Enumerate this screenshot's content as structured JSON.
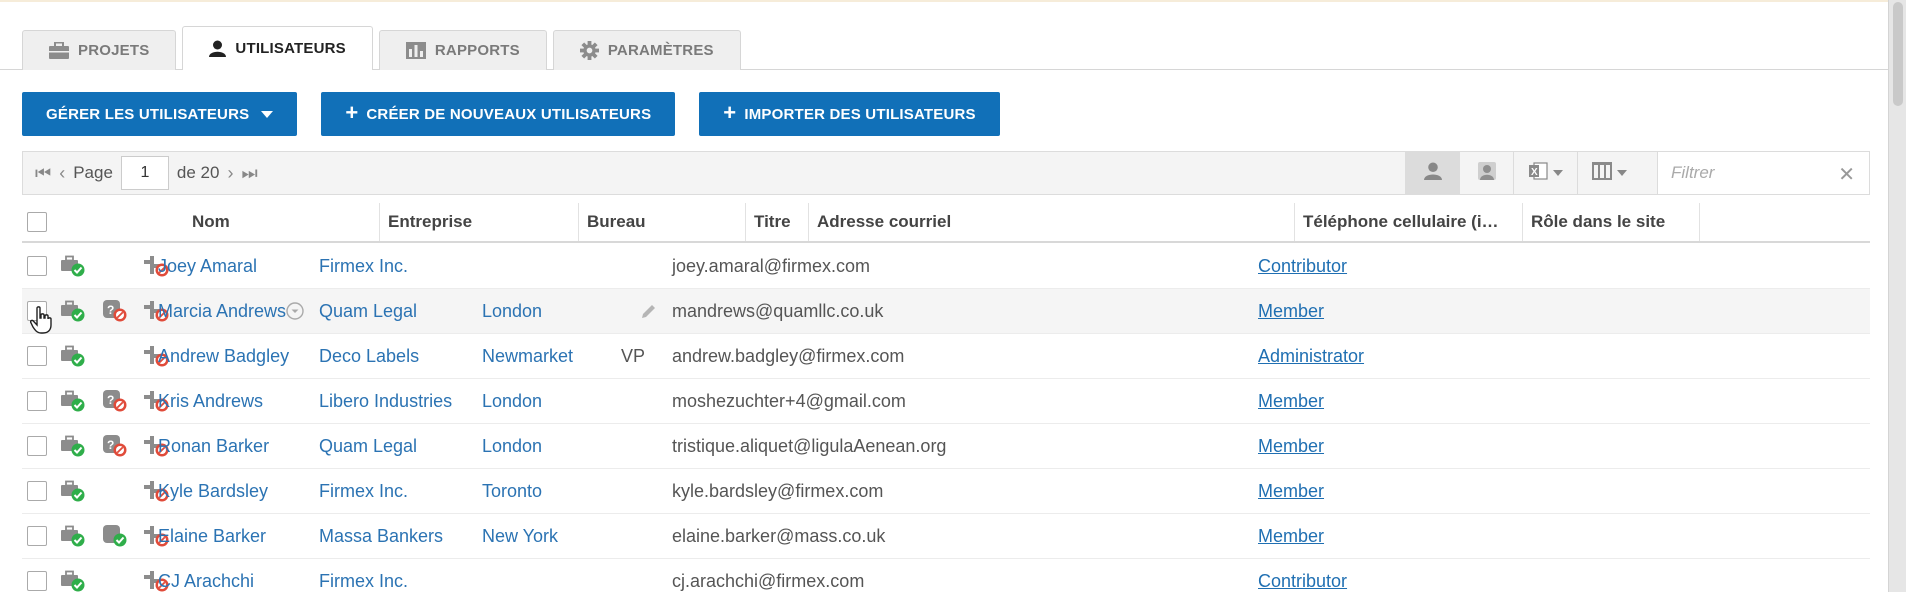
{
  "tabs": [
    {
      "label": "PROJETS",
      "icon": "briefcase-icon",
      "active": false
    },
    {
      "label": "UTILISATEURS",
      "icon": "user-icon",
      "active": true
    },
    {
      "label": "RAPPORTS",
      "icon": "bar-chart-icon",
      "active": false
    },
    {
      "label": "PARAMÈTRES",
      "icon": "gear-icon",
      "active": false
    }
  ],
  "actions": {
    "manage": "GÉRER LES UTILISATEURS",
    "create": "CRÉER DE NOUVEAUX UTILISATEURS",
    "import": "IMPORTER DES UTILISATEURS"
  },
  "pager": {
    "page_label": "Page",
    "current": "1",
    "of_label": "de 20"
  },
  "filter": {
    "placeholder": "Filtrer"
  },
  "columns": {
    "name": "Nom",
    "company": "Entreprise",
    "office": "Bureau",
    "title": "Titre",
    "email": "Adresse courriel",
    "mobile": "Téléphone cellulaire (i…",
    "role": "Rôle dans le site"
  },
  "rows": [
    {
      "name": "Joey Amaral",
      "company": "Firmex Inc.",
      "office": "",
      "title": "",
      "email": "joey.amaral@firmex.com",
      "role": "Contributor",
      "second_icon": "none"
    },
    {
      "name": "Marcia Andrews",
      "company": "Quam Legal",
      "office": "London",
      "title": "",
      "email": "mandrews@quamllc.co.uk",
      "role": "Member",
      "second_icon": "blocked"
    },
    {
      "name": "Andrew Badgley",
      "company": "Deco Labels",
      "office": "Newmarket",
      "title": "VP",
      "email": "andrew.badgley@firmex.com",
      "role": "Administrator",
      "second_icon": "none"
    },
    {
      "name": "Kris Andrews",
      "company": "Libero Industries",
      "office": "London",
      "title": "",
      "email": "moshezuchter+4@gmail.com",
      "role": "Member",
      "second_icon": "blocked"
    },
    {
      "name": "Ronan Barker",
      "company": "Quam Legal",
      "office": "London",
      "title": "",
      "email": "tristique.aliquet@ligulaAenean.org",
      "role": "Member",
      "second_icon": "blocked"
    },
    {
      "name": "Kyle Bardsley",
      "company": "Firmex Inc.",
      "office": "Toronto",
      "title": "",
      "email": "kyle.bardsley@firmex.com",
      "role": "Member",
      "second_icon": "none"
    },
    {
      "name": "Elaine Barker",
      "company": "Massa Bankers",
      "office": "New York",
      "title": "",
      "email": "elaine.barker@mass.co.uk",
      "role": "Member",
      "second_icon": "approved"
    },
    {
      "name": "CJ Arachchi",
      "company": "Firmex Inc.",
      "office": "",
      "title": "",
      "email": "cj.arachchi@firmex.com",
      "role": "Contributor",
      "second_icon": "none"
    }
  ],
  "colors": {
    "accent": "#1170b8",
    "link": "#2b73b3",
    "ok": "#2fae4a",
    "blocked": "#e04b3a"
  }
}
